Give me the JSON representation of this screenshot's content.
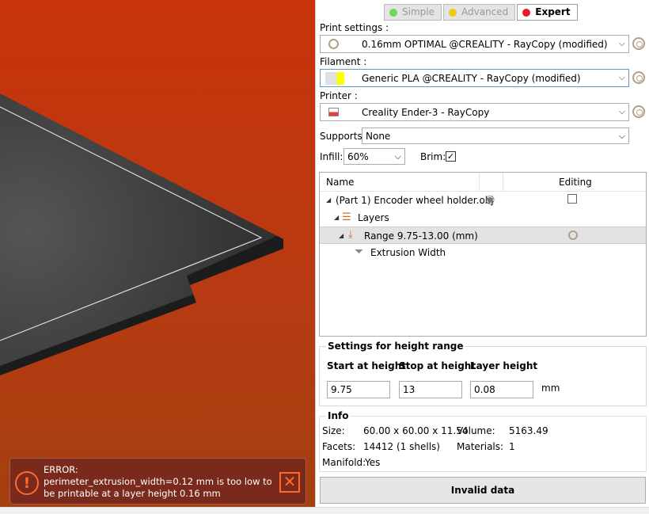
{
  "modes": [
    {
      "label": "Simple",
      "color": "#6cd94e",
      "active": false
    },
    {
      "label": "Advanced",
      "color": "#f2c81a",
      "active": false
    },
    {
      "label": "Expert",
      "color": "#e8192c",
      "active": true
    }
  ],
  "print_settings": {
    "label": "Print settings :",
    "value": "0.16mm OPTIMAL @CREALITY - RayCopy (modified)"
  },
  "filament": {
    "label": "Filament :",
    "value": "Generic PLA @CREALITY - RayCopy (modified)",
    "swatch_color": "#ffff00"
  },
  "printer": {
    "label": "Printer :",
    "value": "Creality Ender-3 - RayCopy"
  },
  "supports": {
    "label": "Supports:",
    "value": "None"
  },
  "infill": {
    "label": "Infill:",
    "value": "60%"
  },
  "brim": {
    "label": "Brim:",
    "checked": true,
    "mark": "✓"
  },
  "object_list": {
    "col_name": "Name",
    "col_editing": "Editing",
    "items": [
      {
        "label": "(Part 1) Encoder wheel holder.obj"
      },
      {
        "label": "Layers"
      },
      {
        "label": "Range 9.75-13.00 (mm)"
      },
      {
        "label": "Extrusion Width"
      }
    ]
  },
  "height_range": {
    "title": "Settings for height range",
    "start_label": "Start at height",
    "stop_label": "Stop at height",
    "layer_label": "Layer height",
    "start_value": "9.75",
    "stop_value": "13",
    "layer_value": "0.08",
    "unit": "mm"
  },
  "info": {
    "title": "Info",
    "size_label": "Size:",
    "size_value": "60.00 x 60.00 x 11.54",
    "volume_label": "Volume:",
    "volume_value": "5163.49",
    "facets_label": "Facets:",
    "facets_value": "14412 (1 shells)",
    "materials_label": "Materials:",
    "materials_value": "1",
    "manifold_label": "Manifold:",
    "manifold_value": "Yes"
  },
  "error": {
    "title": "ERROR:",
    "message": "perimeter_extrusion_width=0.12 mm is too low to be printable at a layer height 0.16 mm",
    "icon_glyph": "!",
    "close_glyph": "✕"
  },
  "action_button": "Invalid data",
  "colors": {
    "accent_error": "#ff6a2a",
    "viewport_bg": "#c8330a"
  }
}
